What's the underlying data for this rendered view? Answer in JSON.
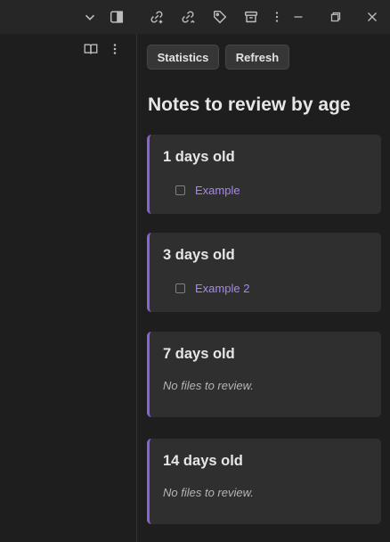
{
  "toolbar": {
    "icons": [
      "chevron-down-icon",
      "sidebar-toggle-icon",
      "link-add-icon",
      "link-add-alt-icon",
      "tag-icon",
      "archive-icon",
      "more-vertical-icon"
    ],
    "window_controls": [
      "minimize-icon",
      "restore-icon",
      "close-icon"
    ]
  },
  "sidebar": {
    "icons": [
      "book-icon",
      "more-vertical-icon"
    ]
  },
  "main": {
    "buttons": {
      "statistics": "Statistics",
      "refresh": "Refresh"
    },
    "heading": "Notes to review by age",
    "groups": [
      {
        "title": "1 days old",
        "files": [
          "Example"
        ]
      },
      {
        "title": "3 days old",
        "files": [
          "Example 2"
        ]
      },
      {
        "title": "7 days old",
        "empty_text": "No files to review."
      },
      {
        "title": "14 days old",
        "empty_text": "No files to review."
      }
    ]
  },
  "colors": {
    "accent": "#8b63d9",
    "link": "#a788ea",
    "card_bg": "#2f2f2f",
    "background": "#1e1e1e"
  }
}
